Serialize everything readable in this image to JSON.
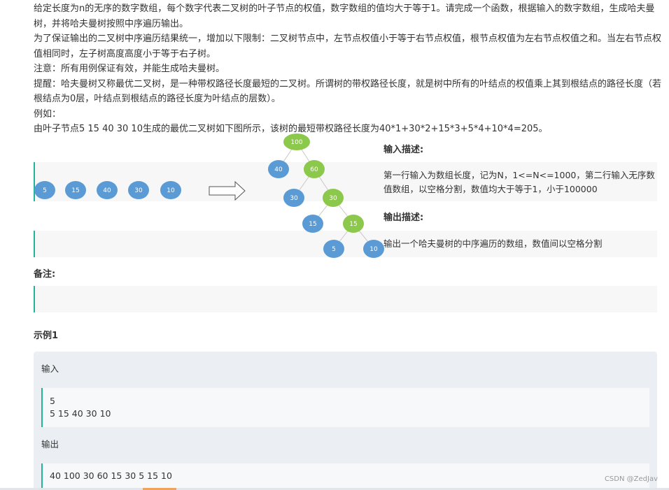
{
  "description": {
    "paragraphs": [
      "给定长度为n的无序的数字数组，每个数字代表二叉树的叶子节点的权值，数字数组的值均大于等于1。请完成一个函数，根据输入的数字数组，生成哈夫曼树，并将哈夫曼树按照中序遍历输出。",
      "为了保证输出的二叉树中序遍历结果统一，增加以下限制：二叉树节点中，左节点权值小于等于右节点权值，根节点权值为左右节点权值之和。当左右节点权值相同时，左子树高度高度小于等于右子树。",
      "注意：所有用例保证有效，并能生成哈夫曼树。",
      "提醒：哈夫曼树又称最优二叉树，是一种带权路径长度最短的二叉树。所谓树的带权路径长度，就是树中所有的叶结点的权值乘上其到根结点的路径长度（若根结点为0层，叶结点到根结点的路径长度为叶结点的层数）。",
      "例如：",
      "由叶子节点5 15 40 30 10生成的最优二叉树如下图所示，该树的最短带权路径长度为40*1+30*2+15*3+5*4+10*4=205。"
    ]
  },
  "diagram": {
    "leaves": [
      "5",
      "15",
      "40",
      "30",
      "10"
    ],
    "tree": {
      "root": "100",
      "level1": [
        "40",
        "60"
      ],
      "level2": [
        "30",
        "30"
      ],
      "level3": [
        "15",
        "15"
      ],
      "level4": [
        "5",
        "10"
      ]
    },
    "colors": {
      "leaf": "#5b9bd5",
      "internal": "#8cc84b"
    }
  },
  "input_desc": {
    "heading": "输入描述:",
    "text": "第一行输入为数组长度，记为N，1<=N<=1000，第二行输入无序数值数组，以空格分割，数值均大于等于1，小于100000"
  },
  "output_desc": {
    "heading": "输出描述:",
    "text": "输出一个哈夫曼树的中序遍历的数组，数值间以空格分割"
  },
  "remark": {
    "heading": "备注:"
  },
  "example": {
    "heading": "示例1",
    "input_label": "输入",
    "input_lines": [
      "5",
      "5 15 40 30 10"
    ],
    "output_label": "输出",
    "output_lines": [
      "40 100 30 60 15 30 5 15 10"
    ]
  },
  "watermark": "CSDN @ZedJav",
  "accent_color": "#22b39b"
}
